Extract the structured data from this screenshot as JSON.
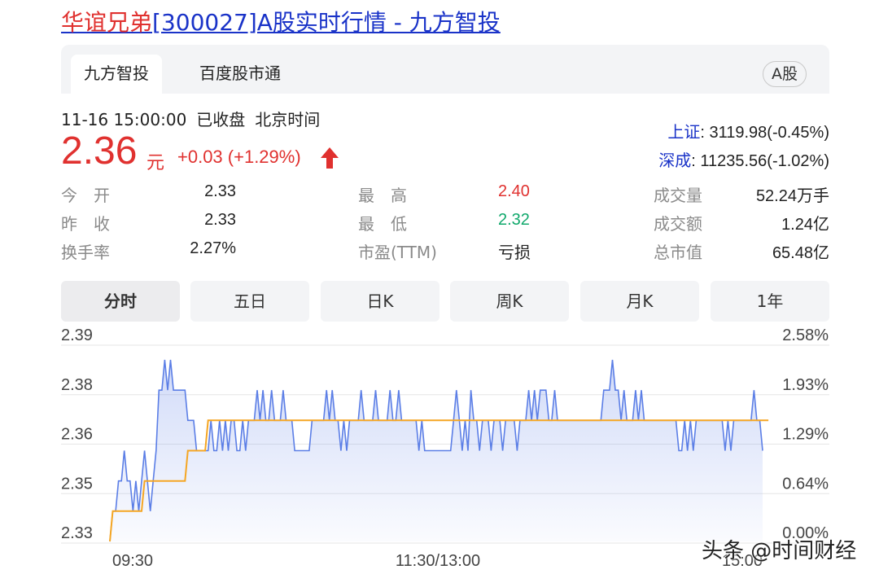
{
  "page": {
    "title_name": "华谊兄弟",
    "title_rest": "[300027]A股实时行情 - 九方智投"
  },
  "tabs": {
    "items": [
      "九方智投",
      "百度股市通"
    ],
    "badge": "A股"
  },
  "quote": {
    "datetime": "11-16 15:00:00",
    "status": "已收盘",
    "timezone": "北京时间",
    "price": "2.36",
    "unit": "元",
    "change": "+0.03 (+1.29%)"
  },
  "indices": [
    {
      "name": "上证",
      "value": ": 3119.98(-0.45%)"
    },
    {
      "name": "深成",
      "value": ": 11235.56(-1.02%)"
    }
  ],
  "stats": [
    {
      "label": "今　开",
      "value": "2.33",
      "color": "#222222"
    },
    {
      "label": "最　高",
      "value": "2.40",
      "color": "#e0312f"
    },
    {
      "label": "成交量",
      "value": "52.24万手",
      "color": "#222222"
    },
    {
      "label": "昨　收",
      "value": "2.33",
      "color": "#222222"
    },
    {
      "label": "最　低",
      "value": "2.32",
      "color": "#0fa86b"
    },
    {
      "label": "成交额",
      "value": "1.24亿",
      "color": "#222222"
    },
    {
      "label": "换手率",
      "value": "2.27%",
      "color": "#222222"
    },
    {
      "label": "市盈(TTM)",
      "value": "亏损",
      "color": "#222222"
    },
    {
      "label": "总市值",
      "value": "65.48亿",
      "color": "#222222"
    }
  ],
  "periods": [
    "分时",
    "五日",
    "日K",
    "周K",
    "月K",
    "1年"
  ],
  "watermark": "头条 @时间财经",
  "colors": {
    "price_line": "#5b7ee6",
    "avg_line": "#f5a623",
    "up": "#e0312f",
    "down": "#0fa86b",
    "index_name": "#1a33c8"
  },
  "chart_data": {
    "type": "line",
    "y_left_ticks": [
      "2.39",
      "2.38",
      "2.36",
      "2.35",
      "2.33"
    ],
    "y_right_ticks": [
      "2.58%",
      "1.93%",
      "1.29%",
      "0.64%",
      "0.00%"
    ],
    "x_ticks": [
      "09:30",
      "11:30/13:00",
      "15:00"
    ],
    "ylim": [
      2.33,
      2.39
    ],
    "reference_close": 2.33,
    "grid": true,
    "series": [
      {
        "values": [
          2.33,
          2.34,
          2.34,
          2.35,
          2.35,
          2.36,
          2.35,
          2.35,
          2.34,
          2.35,
          2.34,
          2.35,
          2.36,
          2.35,
          2.34,
          2.35,
          2.36,
          2.38,
          2.38,
          2.39,
          2.38,
          2.39,
          2.38,
          2.38,
          2.38,
          2.38,
          2.38,
          2.37,
          2.37,
          2.37,
          2.36,
          2.36,
          2.36,
          2.36,
          2.36,
          2.37,
          2.36,
          2.36,
          2.37,
          2.36,
          2.37,
          2.36,
          2.37,
          2.37,
          2.36,
          2.36,
          2.37,
          2.36,
          2.37,
          2.37,
          2.37,
          2.38,
          2.37,
          2.38,
          2.37,
          2.37,
          2.38,
          2.37,
          2.37,
          2.37,
          2.38,
          2.37,
          2.37,
          2.37,
          2.36,
          2.36,
          2.36,
          2.36,
          2.36,
          2.36,
          2.37,
          2.37,
          2.37,
          2.37,
          2.37,
          2.38,
          2.37,
          2.38,
          2.37,
          2.37,
          2.36,
          2.37,
          2.36,
          2.37,
          2.37,
          2.37,
          2.37,
          2.38,
          2.37,
          2.37,
          2.37,
          2.37,
          2.38,
          2.37,
          2.37,
          2.37,
          2.37,
          2.38,
          2.37,
          2.37,
          2.38,
          2.37,
          2.37,
          2.37,
          2.37,
          2.37,
          2.37,
          2.36,
          2.37,
          2.36,
          2.36,
          2.36,
          2.36,
          2.36,
          2.36,
          2.36,
          2.36,
          2.36,
          2.36,
          2.37,
          2.38,
          2.37,
          2.36,
          2.37,
          2.36,
          2.38,
          2.37,
          2.37,
          2.36,
          2.37,
          2.37,
          2.37,
          2.36,
          2.37,
          2.37,
          2.37,
          2.36,
          2.37,
          2.37,
          2.37,
          2.37,
          2.36,
          2.37,
          2.37,
          2.37,
          2.38,
          2.37,
          2.38,
          2.37,
          2.38,
          2.38,
          2.38,
          2.37,
          2.37,
          2.38,
          2.37,
          2.37,
          2.37,
          2.37,
          2.37,
          2.37,
          2.37,
          2.37,
          2.37,
          2.37,
          2.37,
          2.37,
          2.37,
          2.37,
          2.37,
          2.37,
          2.38,
          2.38,
          2.38,
          2.39,
          2.38,
          2.38,
          2.37,
          2.38,
          2.37,
          2.37,
          2.37,
          2.38,
          2.37,
          2.38,
          2.37,
          2.37,
          2.37,
          2.37,
          2.37,
          2.37,
          2.37,
          2.37,
          2.37,
          2.37,
          2.37,
          2.37,
          2.36,
          2.36,
          2.37,
          2.36,
          2.37,
          2.36,
          2.37,
          2.37,
          2.37,
          2.37,
          2.37,
          2.37,
          2.37,
          2.37,
          2.37,
          2.37,
          2.36,
          2.37,
          2.36,
          2.37,
          2.37,
          2.37,
          2.37,
          2.37,
          2.37,
          2.37,
          2.38,
          2.37,
          2.37,
          2.36
        ]
      },
      {
        "values": [
          2.33,
          2.34,
          2.34,
          2.34,
          2.34,
          2.34,
          2.34,
          2.34,
          2.34,
          2.34,
          2.34,
          2.34,
          2.35,
          2.35,
          2.35,
          2.35,
          2.35,
          2.35,
          2.35,
          2.35,
          2.35,
          2.35,
          2.35,
          2.35,
          2.35,
          2.35,
          2.35,
          2.36,
          2.36,
          2.36,
          2.36,
          2.36,
          2.36,
          2.36,
          2.37,
          2.37,
          2.37,
          2.37,
          2.37,
          2.37,
          2.37,
          2.37,
          2.37,
          2.37,
          2.37,
          2.37,
          2.37,
          2.37,
          2.37,
          2.37,
          2.37,
          2.37,
          2.37,
          2.37,
          2.37,
          2.37,
          2.37,
          2.37,
          2.37,
          2.37,
          2.37,
          2.37,
          2.37,
          2.37,
          2.37,
          2.37,
          2.37,
          2.37,
          2.37,
          2.37,
          2.37,
          2.37,
          2.37,
          2.37,
          2.37,
          2.37,
          2.37,
          2.37,
          2.37,
          2.37,
          2.37,
          2.37,
          2.37,
          2.37,
          2.37,
          2.37,
          2.37,
          2.37,
          2.37,
          2.37,
          2.37,
          2.37,
          2.37,
          2.37,
          2.37,
          2.37,
          2.37,
          2.37,
          2.37,
          2.37,
          2.37,
          2.37,
          2.37,
          2.37,
          2.37,
          2.37,
          2.37,
          2.37,
          2.37,
          2.37,
          2.37,
          2.37,
          2.37,
          2.37,
          2.37,
          2.37,
          2.37,
          2.37,
          2.37,
          2.37,
          2.37,
          2.37,
          2.37,
          2.37,
          2.37,
          2.37,
          2.37,
          2.37,
          2.37,
          2.37,
          2.37,
          2.37,
          2.37,
          2.37,
          2.37,
          2.37,
          2.37,
          2.37,
          2.37,
          2.37,
          2.37,
          2.37,
          2.37,
          2.37,
          2.37,
          2.37,
          2.37,
          2.37,
          2.37,
          2.37,
          2.37,
          2.37,
          2.37,
          2.37,
          2.37,
          2.37,
          2.37,
          2.37,
          2.37,
          2.37,
          2.37,
          2.37,
          2.37,
          2.37,
          2.37,
          2.37,
          2.37,
          2.37,
          2.37,
          2.37,
          2.37,
          2.37,
          2.37,
          2.37,
          2.37,
          2.37,
          2.37,
          2.37,
          2.37,
          2.37,
          2.37,
          2.37,
          2.37,
          2.37,
          2.37,
          2.37,
          2.37,
          2.37,
          2.37,
          2.37,
          2.37,
          2.37,
          2.37,
          2.37,
          2.37,
          2.37,
          2.37,
          2.37,
          2.37,
          2.37,
          2.37,
          2.37,
          2.37,
          2.37,
          2.37,
          2.37,
          2.37,
          2.37,
          2.37,
          2.37,
          2.37,
          2.37,
          2.37,
          2.37,
          2.37,
          2.37,
          2.37,
          2.37,
          2.37,
          2.37,
          2.37,
          2.37,
          2.37,
          2.37,
          2.37,
          2.37,
          2.37,
          2.37,
          2.37
        ]
      }
    ]
  }
}
